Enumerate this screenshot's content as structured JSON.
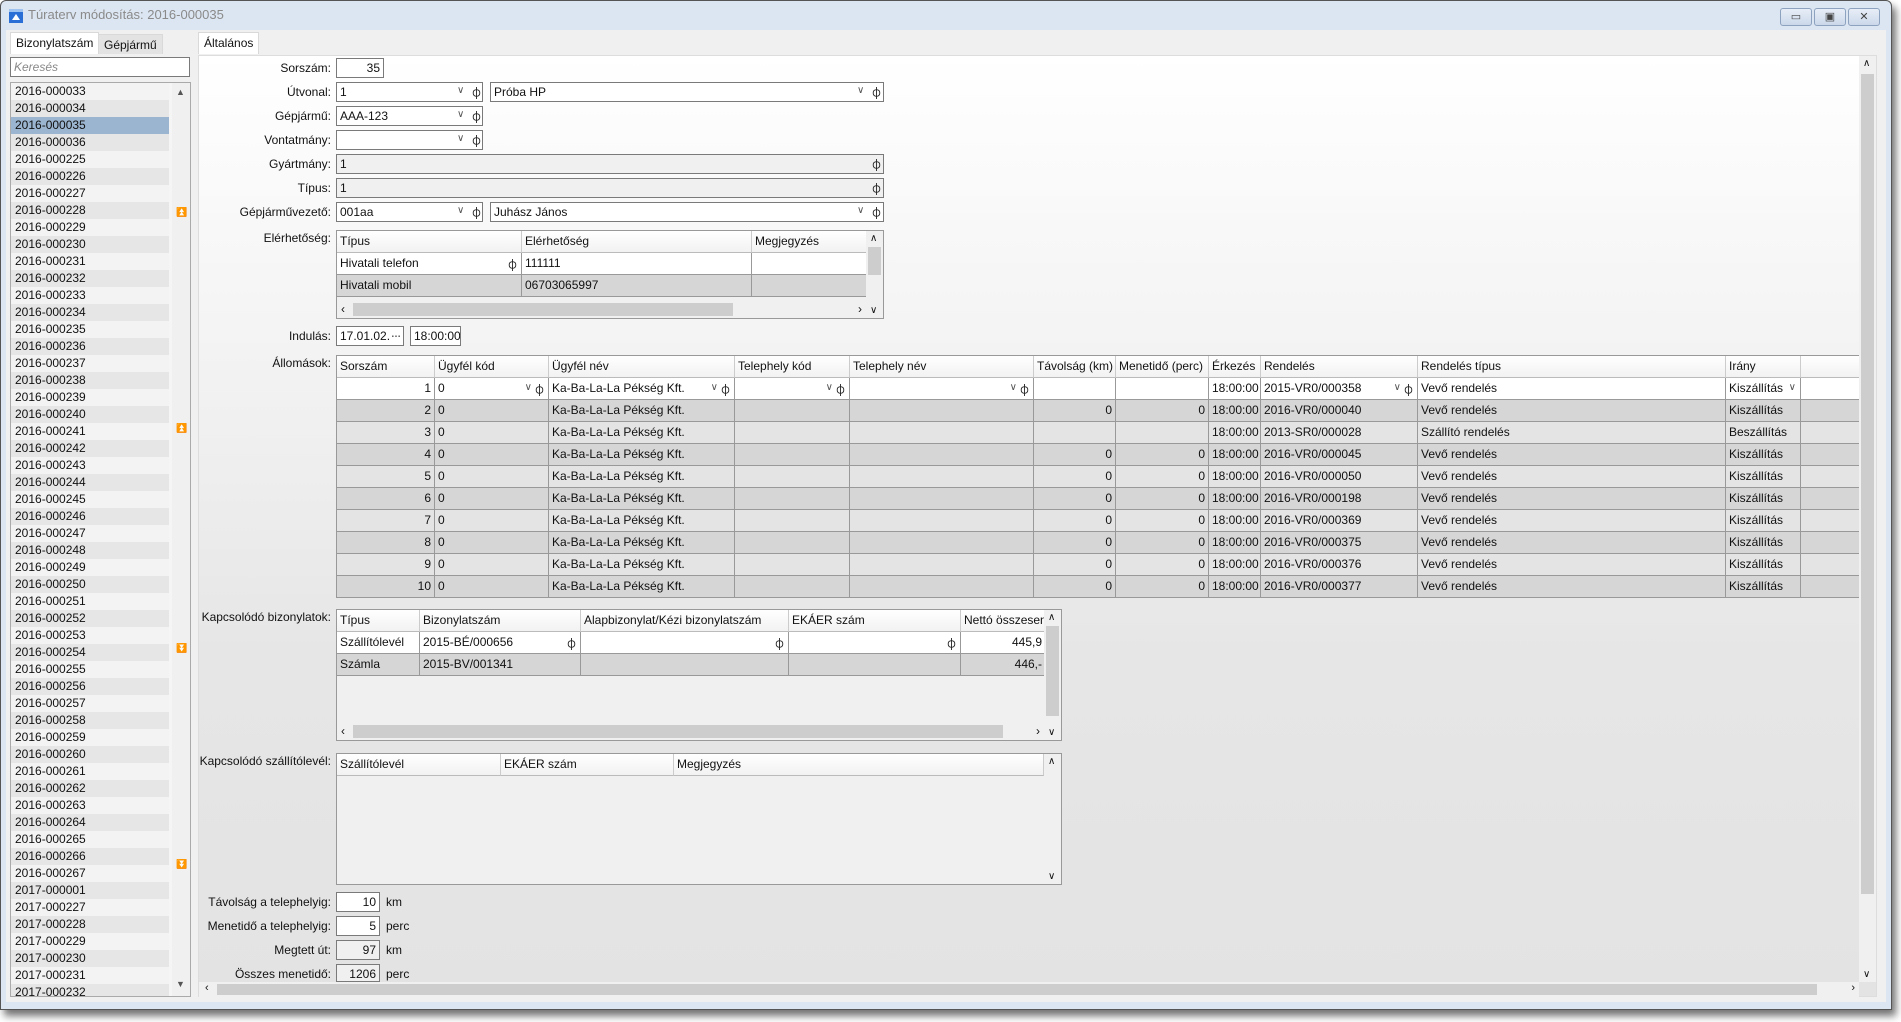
{
  "window": {
    "title": "Túraterv módosítás: 2016-000035",
    "buttons": {
      "minimize": "▭",
      "maximize": "▣",
      "close": "✕"
    }
  },
  "left": {
    "tabs": [
      "Bizonylatszám",
      "Gépjármű"
    ],
    "search_placeholder": "Keresés",
    "selected": "2016-000035",
    "items": [
      "2016-000033",
      "2016-000034",
      "2016-000035",
      "2016-000036",
      "2016-000225",
      "2016-000226",
      "2016-000227",
      "2016-000228",
      "2016-000229",
      "2016-000230",
      "2016-000231",
      "2016-000232",
      "2016-000233",
      "2016-000234",
      "2016-000235",
      "2016-000236",
      "2016-000237",
      "2016-000238",
      "2016-000239",
      "2016-000240",
      "2016-000241",
      "2016-000242",
      "2016-000243",
      "2016-000244",
      "2016-000245",
      "2016-000246",
      "2016-000247",
      "2016-000248",
      "2016-000249",
      "2016-000250",
      "2016-000251",
      "2016-000252",
      "2016-000253",
      "2016-000254",
      "2016-000255",
      "2016-000256",
      "2016-000257",
      "2016-000258",
      "2016-000259",
      "2016-000260",
      "2016-000261",
      "2016-000262",
      "2016-000263",
      "2016-000264",
      "2016-000265",
      "2016-000266",
      "2016-000267",
      "2017-000001",
      "2017-000227",
      "2017-000228",
      "2017-000229",
      "2017-000230",
      "2017-000231",
      "2017-000232"
    ]
  },
  "main": {
    "tab": "Általános",
    "labels": {
      "sorszam": "Sorszám:",
      "utvonal": "Útvonal:",
      "gepjarmu": "Gépjármű:",
      "vontatmany": "Vontatmány:",
      "gyartmany": "Gyártmány:",
      "tipus": "Típus:",
      "sofor": "Gépjárművezető:",
      "elerhetoseg": "Elérhetőség:",
      "indulas": "Indulás:",
      "allomasok": "Állomások:",
      "kapcs_biz": "Kapcsolódó bizonylatok:",
      "kapcs_szall": "Kapcsolódó szállítólevél:",
      "tav": "Távolság a telephelyig:",
      "menet": "Menetidő a telephelyig:",
      "megtett": "Megtett út:",
      "osszes": "Összes menetidő:"
    },
    "values": {
      "sorszam": "35",
      "utvonal_kod": "1",
      "utvonal_nev": "Próba HP",
      "gepjarmu": "AAA-123",
      "vontatmany": "",
      "gyartmany": "1",
      "tipus": "1",
      "sofor_kod": "001aa",
      "sofor_nev": "Juhász János",
      "indulas_datum": "17.01.02.",
      "indulas_ido": "18:00:00",
      "tav": "10",
      "menet": "5",
      "megtett": "97",
      "osszes": "1206"
    },
    "units": {
      "km": "km",
      "perc": "perc"
    },
    "contacts": {
      "columns": [
        "Típus",
        "Elérhetőség",
        "Megjegyzés"
      ],
      "rows": [
        [
          "Hivatali telefon",
          "111111",
          ""
        ],
        [
          "Hivatali mobil",
          "06703065997",
          ""
        ]
      ]
    },
    "stations": {
      "columns": [
        "Sorszám",
        "Ügyfél kód",
        "Ügyfél név",
        "Telephely kód",
        "Telephely név",
        "Távolság (km)",
        "Menetidő (perc)",
        "Érkezés",
        "Rendelés",
        "Rendelés típus",
        "Irány",
        ""
      ],
      "rows": [
        [
          "1",
          "0",
          "Ka-Ba-La-La Pékség Kft.",
          "",
          "",
          "",
          "",
          "18:00:00",
          "2015-VR0/000358",
          "Vevő rendelés",
          "Kiszállítás",
          ""
        ],
        [
          "2",
          "0",
          "Ka-Ba-La-La Pékség Kft.",
          "",
          "",
          "0",
          "0",
          "18:00:00",
          "2016-VR0/000040",
          "Vevő rendelés",
          "Kiszállítás",
          ""
        ],
        [
          "3",
          "0",
          "Ka-Ba-La-La Pékség Kft.",
          "",
          "",
          "",
          "",
          "18:00:00",
          "2013-SR0/000028",
          "Szállító rendelés",
          "Beszállítás",
          ""
        ],
        [
          "4",
          "0",
          "Ka-Ba-La-La Pékség Kft.",
          "",
          "",
          "0",
          "0",
          "18:00:00",
          "2016-VR0/000045",
          "Vevő rendelés",
          "Kiszállítás",
          ""
        ],
        [
          "5",
          "0",
          "Ka-Ba-La-La Pékség Kft.",
          "",
          "",
          "0",
          "0",
          "18:00:00",
          "2016-VR0/000050",
          "Vevő rendelés",
          "Kiszállítás",
          ""
        ],
        [
          "6",
          "0",
          "Ka-Ba-La-La Pékség Kft.",
          "",
          "",
          "0",
          "0",
          "18:00:00",
          "2016-VR0/000198",
          "Vevő rendelés",
          "Kiszállítás",
          ""
        ],
        [
          "7",
          "0",
          "Ka-Ba-La-La Pékség Kft.",
          "",
          "",
          "0",
          "0",
          "18:00:00",
          "2016-VR0/000369",
          "Vevő rendelés",
          "Kiszállítás",
          ""
        ],
        [
          "8",
          "0",
          "Ka-Ba-La-La Pékség Kft.",
          "",
          "",
          "0",
          "0",
          "18:00:00",
          "2016-VR0/000375",
          "Vevő rendelés",
          "Kiszállítás",
          ""
        ],
        [
          "9",
          "0",
          "Ka-Ba-La-La Pékség Kft.",
          "",
          "",
          "0",
          "0",
          "18:00:00",
          "2016-VR0/000376",
          "Vevő rendelés",
          "Kiszállítás",
          ""
        ],
        [
          "10",
          "0",
          "Ka-Ba-La-La Pékség Kft.",
          "",
          "",
          "0",
          "0",
          "18:00:00",
          "2016-VR0/000377",
          "Vevő rendelés",
          "Kiszállítás",
          ""
        ]
      ]
    },
    "docs": {
      "columns": [
        "Típus",
        "Bizonylatszám",
        "Alapbizonylat/Kézi bizonylatszám",
        "EKÁER szám",
        "Nettó összesen"
      ],
      "rows": [
        [
          "Szállítólevél",
          "2015-BÉ/000656",
          "",
          "",
          "445,9"
        ],
        [
          "Számla",
          "2015-BV/001341",
          "",
          "",
          "446,-"
        ]
      ]
    },
    "delivery": {
      "columns": [
        "Szállítólevél",
        "EKÁER szám",
        "Megjegyzés"
      ],
      "rows": []
    }
  }
}
